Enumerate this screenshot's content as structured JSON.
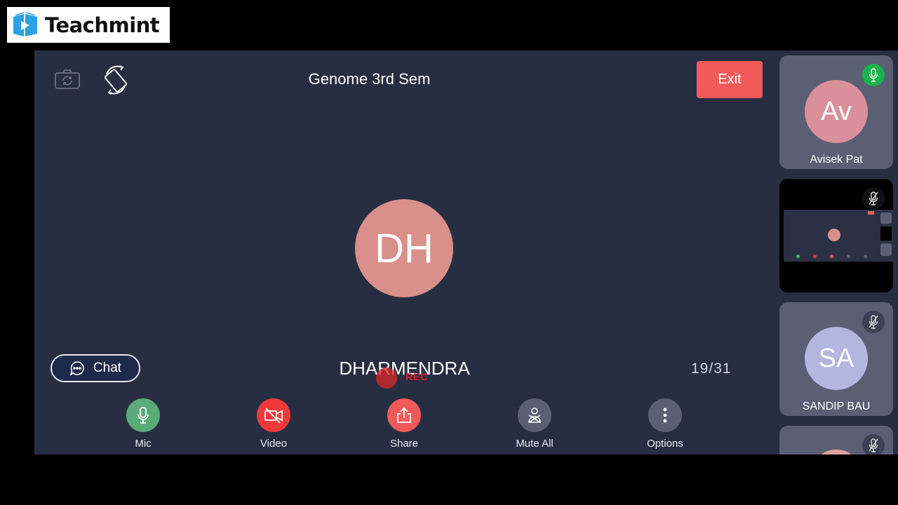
{
  "brand": {
    "name": "Teachmint",
    "icon": "teachmint-book-play-icon",
    "color": "#2aa3e0"
  },
  "header": {
    "title": "Genome 3rd Sem",
    "switch_camera_icon": "camera-switch-icon",
    "rotate_icon": "screen-rotate-icon",
    "exit_label": "Exit"
  },
  "main": {
    "speaker_initials": "DH",
    "speaker_name": "DHARMENDRA",
    "recording_label": "REC",
    "participant_counter": "19/31",
    "chat_label": "Chat"
  },
  "controls": [
    {
      "id": "mic",
      "label": "Mic",
      "icon": "microphone-icon",
      "color": "#5aaa78"
    },
    {
      "id": "video",
      "label": "Video",
      "icon": "video-off-icon",
      "color": "#f03a3a"
    },
    {
      "id": "share",
      "label": "Share",
      "icon": "share-icon",
      "color": "#f25a5a"
    },
    {
      "id": "mute-all",
      "label": "Mute All",
      "icon": "mute-all-icon",
      "color": "#5a5f74"
    },
    {
      "id": "options",
      "label": "Options",
      "icon": "more-vertical-icon",
      "color": "#5a5f74"
    }
  ],
  "participants": [
    {
      "initials": "Av",
      "name": "Avisek Pat",
      "mic": "on",
      "avatar_color": "#d9909a"
    },
    {
      "initials": "",
      "name": "",
      "mic": "off",
      "type": "screen-share"
    },
    {
      "initials": "SA",
      "name": "SANDIP BAU",
      "mic": "off",
      "avatar_color": "#b3b6de"
    },
    {
      "initials": "",
      "name": "",
      "mic": "off",
      "avatar_color": "#e0a09a"
    }
  ],
  "colors": {
    "stage_bg": "#282e42",
    "tile_bg": "#5a5f74",
    "exit": "#f25a5a",
    "mic_on": "#1bb34a"
  }
}
